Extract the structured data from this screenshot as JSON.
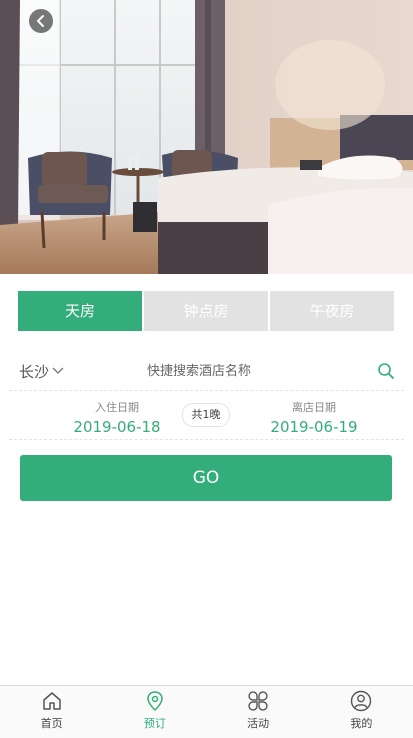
{
  "hero": {
    "back_icon": "chevron-left-icon"
  },
  "tabs": [
    {
      "label": "天房",
      "active": true
    },
    {
      "label": "钟点房",
      "active": false
    },
    {
      "label": "午夜房",
      "active": false
    }
  ],
  "search": {
    "city": "长沙",
    "city_icon": "chevron-down-icon",
    "placeholder": "快捷搜索酒店名称",
    "search_icon": "search-icon"
  },
  "dates": {
    "checkin_label": "入住日期",
    "checkin_date": "2019-06-18",
    "nights": "共1晚",
    "checkout_label": "离店日期",
    "checkout_date": "2019-06-19"
  },
  "go_label": "GO",
  "nav": [
    {
      "label": "首页",
      "icon": "home-icon",
      "active": false
    },
    {
      "label": "预订",
      "icon": "location-pin-icon",
      "active": true
    },
    {
      "label": "活动",
      "icon": "clover-icon",
      "active": false
    },
    {
      "label": "我的",
      "icon": "user-icon",
      "active": false
    }
  ],
  "colors": {
    "accent": "#33ad7a",
    "tab_inactive": "#e2e2e2"
  }
}
